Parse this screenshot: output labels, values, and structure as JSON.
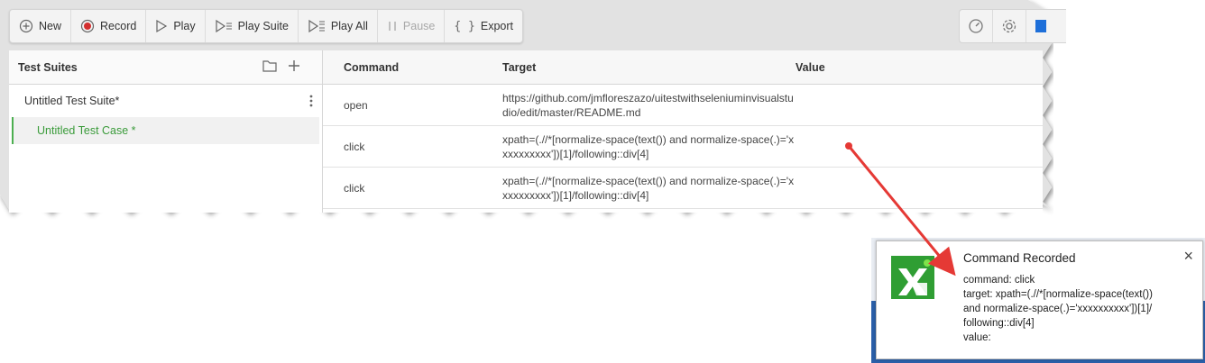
{
  "toolbar": {
    "new": "New",
    "record": "Record",
    "play": "Play",
    "play_suite": "Play Suite",
    "play_all": "Play All",
    "pause": "Pause",
    "export": "Export"
  },
  "right_toolbar": {
    "icons": [
      "speedometer-icon",
      "gear-icon",
      "blue-square-icon"
    ]
  },
  "test_suites": {
    "title": "Test Suites",
    "suite": "Untitled Test Suite*",
    "case": "Untitled Test Case *"
  },
  "table": {
    "headers": {
      "command": "Command",
      "target": "Target",
      "value": "Value"
    },
    "rows": [
      {
        "command": "open",
        "target": "https://github.com/jmfloreszazo/uitestwithseleniuminvisualstudio/edit/master/README.md",
        "value": ""
      },
      {
        "command": "click",
        "target": "xpath=(.//*[normalize-space(text()) and normalize-space(.)='xxxxxxxxxx'])[1]/following::div[4]",
        "value": ""
      },
      {
        "command": "click",
        "target": "xpath=(.//*[normalize-space(text()) and normalize-space(.)='xxxxxxxxxx'])[1]/following::div[4]",
        "value": ""
      }
    ]
  },
  "notification": {
    "title": "Command Recorded",
    "line1": "command: click",
    "line2": "target: xpath=(.//*[normalize-space(text())",
    "line3": "and normalize-space(.)='xxxxxxxxxx'])[1]/",
    "line4": "following::div[4]",
    "line5": "value:",
    "close": "×"
  },
  "colors": {
    "accent_green": "#3a9b3a",
    "record_red": "#d32f2f",
    "arrow_red": "#e53935",
    "logo_green": "#2f9e33"
  }
}
